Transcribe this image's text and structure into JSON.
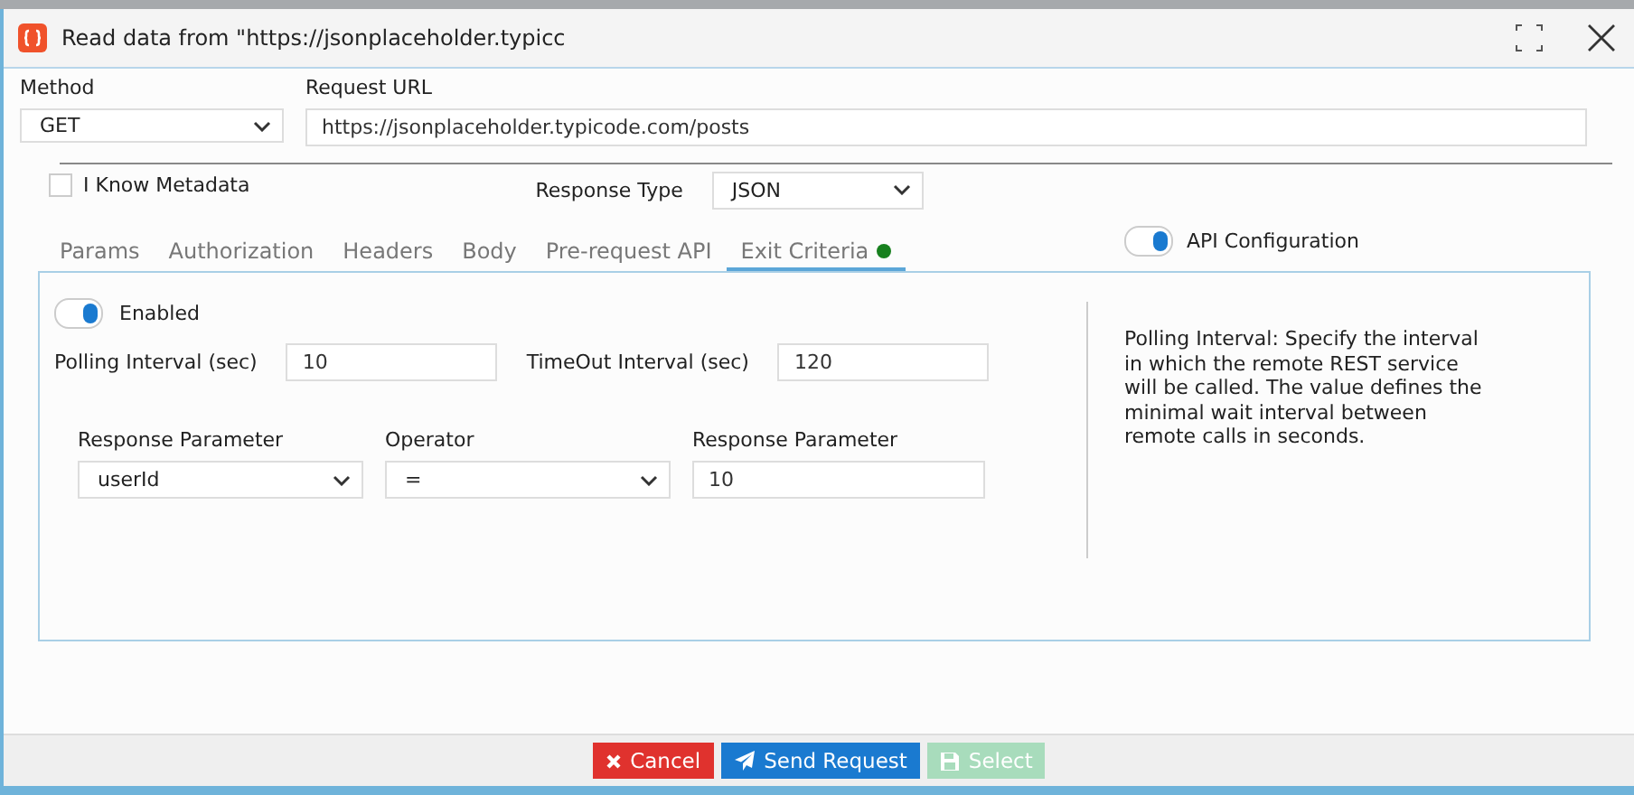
{
  "window": {
    "title": "Read data from \"https://jsonplaceholder.typicc"
  },
  "method": {
    "label": "Method",
    "value": "GET"
  },
  "request_url": {
    "label": "Request URL",
    "value": "https://jsonplaceholder.typicode.com/posts"
  },
  "know_metadata": {
    "label": "I Know Metadata",
    "checked": false
  },
  "response_type": {
    "label": "Response Type",
    "value": "JSON"
  },
  "tabs": [
    {
      "label": "Params",
      "selected": false,
      "indicator": false
    },
    {
      "label": "Authorization",
      "selected": false,
      "indicator": false
    },
    {
      "label": "Headers",
      "selected": false,
      "indicator": false
    },
    {
      "label": "Body",
      "selected": false,
      "indicator": false
    },
    {
      "label": "Pre-request API",
      "selected": false,
      "indicator": false
    },
    {
      "label": "Exit Criteria",
      "selected": true,
      "indicator": true
    }
  ],
  "api_configuration": {
    "label": "API Configuration",
    "on": true
  },
  "enabled": {
    "label": "Enabled",
    "on": true
  },
  "polling_interval": {
    "label": "Polling Interval (sec)",
    "value": "10"
  },
  "timeout_interval": {
    "label": "TimeOut Interval (sec)",
    "value": "120"
  },
  "criteria": [
    {
      "kind": "select",
      "label": "Response Parameter",
      "value": "userId"
    },
    {
      "kind": "select",
      "label": "Operator",
      "value": "="
    },
    {
      "kind": "input",
      "label": "Response Parameter",
      "value": "10"
    }
  ],
  "help_text": "Polling Interval: Specify the interval in which the remote REST service will be called. The value defines the minimal wait interval between remote calls in seconds.",
  "buttons": [
    {
      "kind": "cancel",
      "label": "Cancel",
      "disabled": false
    },
    {
      "kind": "send",
      "label": "Send Request",
      "disabled": false
    },
    {
      "kind": "save",
      "label": "Select",
      "disabled": true
    }
  ]
}
